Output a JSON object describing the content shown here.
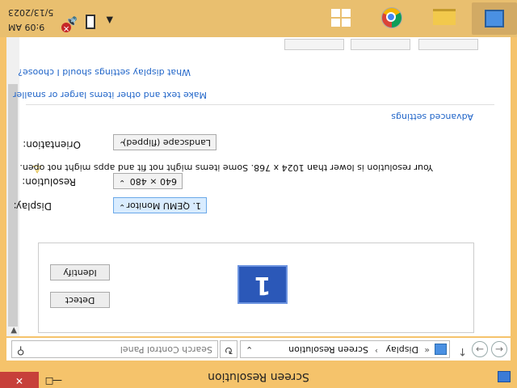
{
  "window": {
    "title": "Screen Resolution",
    "controls": {
      "minimize": "—",
      "maximize": "☐",
      "close": "✕"
    }
  },
  "address_bar": {
    "back": "←",
    "forward": "→",
    "up": "↑",
    "breadcrumb_sep0": "«",
    "breadcrumbs": [
      "Display",
      "Screen Resolution"
    ],
    "breadcrumb_sep": "›",
    "dropdown_arrow": "⌄",
    "refresh": "↻",
    "search_placeholder": "Search Control Panel",
    "search_icon_glyph": "⚲"
  },
  "preview": {
    "monitor_number": "1",
    "identify_label": "Identify",
    "detect_label": "Detect"
  },
  "settings": {
    "display_label": "Display:",
    "display_value": "1. QEMU Monitor",
    "resolution_label": "Resolution:",
    "resolution_value": "640 × 480",
    "warning_icon": "⚠",
    "warning_text": "Your resolution is lower than 1024 x 768. Some items might not fit and apps might not open.",
    "orientation_label": "Orientation:",
    "orientation_value": "Landscape (flipped)",
    "dropdown_arrow": "⌄",
    "advanced_link": "Advanced settings"
  },
  "links": {
    "text_size": "Make text and other items larger or smaller",
    "help": "What display settings should I choose?"
  },
  "taskbar": {
    "apps": [
      "control-panel",
      "file-explorer",
      "chrome",
      "start"
    ],
    "tray_arrow": "▲",
    "speaker_glyph": "🔈",
    "mute_glyph": "✕",
    "clock_time": "9:09 AM",
    "clock_date": "5/13/2023"
  }
}
